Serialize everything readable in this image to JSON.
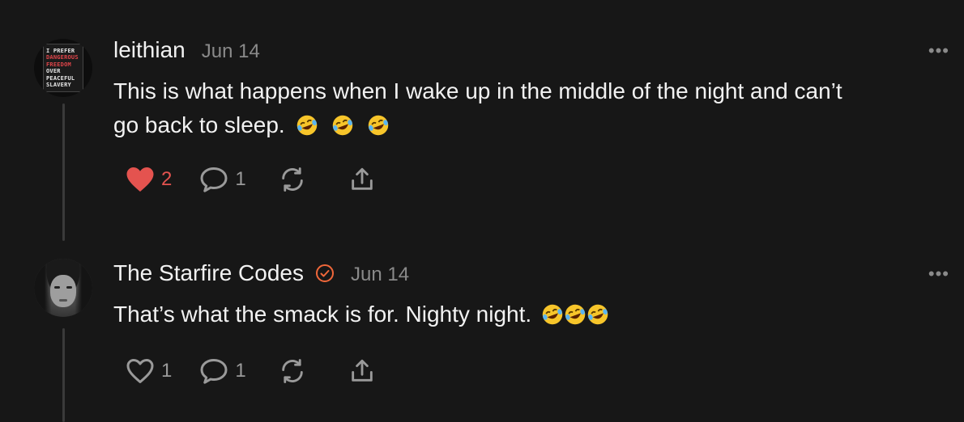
{
  "colors": {
    "background": "#171717",
    "text": "#f2f2f2",
    "muted": "#8a8a8a",
    "like_red": "#e4534f",
    "verified_orange": "#f0673a"
  },
  "posts": [
    {
      "author": "leithian",
      "date": "Jun 14",
      "verified": false,
      "avatar_icon": "book-cover-avatar",
      "avatar_text": [
        "I PREFER",
        "DANGEROUS",
        "FREEDOM",
        "OVER",
        "PEACEFUL",
        "SLAVERY"
      ],
      "text_line1": "This is what happens when I wake up in the middle of the night and can’t",
      "text_line2": "go back to sleep.",
      "emoji_count": 3,
      "emoji_name": "rolling-on-floor-laughing",
      "likes": "2",
      "liked": true,
      "comments": "1"
    },
    {
      "author": "The Starfire Codes",
      "date": "Jun 14",
      "verified": true,
      "avatar_icon": "user-photo-avatar",
      "text_line1": "That’s what the smack is for. Nighty night.",
      "emoji_count": 3,
      "emoji_name": "rolling-on-floor-laughing",
      "likes": "1",
      "liked": false,
      "comments": "1"
    }
  ],
  "more_label": "•••"
}
